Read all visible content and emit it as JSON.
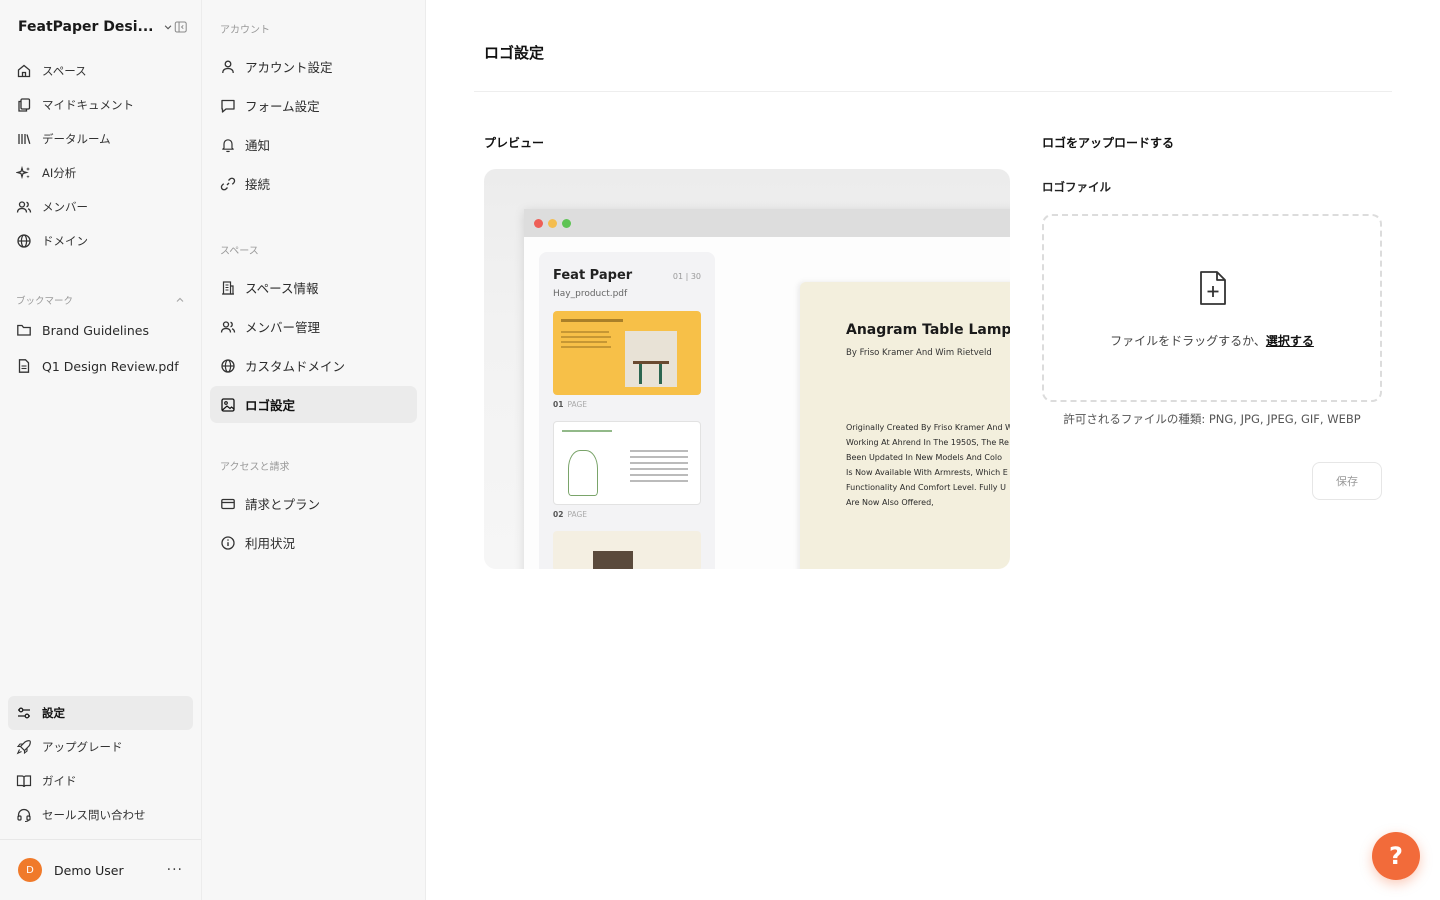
{
  "workspace": {
    "name": "FeatPaper Desi..."
  },
  "sidebar": {
    "items": [
      {
        "label": "スペース",
        "icon": "home-icon"
      },
      {
        "label": "マイドキュメント",
        "icon": "documents-icon"
      },
      {
        "label": "データルーム",
        "icon": "library-icon"
      },
      {
        "label": "AI分析",
        "icon": "sparkles-icon"
      },
      {
        "label": "メンバー",
        "icon": "users-icon"
      },
      {
        "label": "ドメイン",
        "icon": "globe-icon"
      }
    ],
    "bookmarks_title": "ブックマーク",
    "bookmarks": [
      {
        "label": "Brand Guidelines",
        "icon": "folder-icon"
      },
      {
        "label": "Q1 Design Review.pdf",
        "icon": "file-icon"
      }
    ],
    "bottom_items": [
      {
        "label": "設定",
        "icon": "sliders-icon",
        "active": true
      },
      {
        "label": "アップグレード",
        "icon": "rocket-icon"
      },
      {
        "label": "ガイド",
        "icon": "book-icon"
      },
      {
        "label": "セールス問い合わせ",
        "icon": "headset-icon"
      }
    ],
    "user": {
      "initial": "D",
      "name": "Demo User",
      "more": "···"
    }
  },
  "subnav": {
    "sections": [
      {
        "title": "アカウント",
        "items": [
          {
            "label": "アカウント設定",
            "icon": "user-icon"
          },
          {
            "label": "フォーム設定",
            "icon": "message-square-icon"
          },
          {
            "label": "通知",
            "icon": "bell-icon"
          },
          {
            "label": "接続",
            "icon": "link-icon"
          }
        ]
      },
      {
        "title": "スペース",
        "items": [
          {
            "label": "スペース情報",
            "icon": "building-icon"
          },
          {
            "label": "メンバー管理",
            "icon": "users-icon"
          },
          {
            "label": "カスタムドメイン",
            "icon": "globe-icon"
          },
          {
            "label": "ロゴ設定",
            "icon": "image-icon",
            "active": true
          }
        ]
      },
      {
        "title": "アクセスと請求",
        "items": [
          {
            "label": "請求とプラン",
            "icon": "credit-card-icon"
          },
          {
            "label": "利用状況",
            "icon": "info-icon"
          }
        ]
      }
    ]
  },
  "main": {
    "title": "ロゴ設定",
    "preview_label": "プレビュー",
    "preview": {
      "brand": "Feat Paper",
      "page_count": "01 | 30",
      "file_name": "Hay_product.pdf",
      "thumb1_label": "01",
      "thumb2_label": "02",
      "page_word": "PAGE",
      "doc_title": "Anagram Table Lamp",
      "doc_subtitle": "By Friso Kramer And Wim Rietveld",
      "doc_lines": [
        "Originally Created By Friso Kramer And W",
        "Working At Ahrend In The 1950S, The Re",
        "Been Updated In New Models And Colo",
        "Is Now Available With Armrests, Which E",
        "Functionality And Comfort Level. Fully U",
        "Are Now Also Offered,"
      ]
    },
    "upload_label": "ロゴをアップロードする",
    "file_label": "ロゴファイル",
    "dropzone_text": "ファイルをドラッグするか、",
    "dropzone_link": "選択する",
    "allowed_types": "許可されるファイルの種類: PNG, JPG, JPEG, GIF, WEBP",
    "save_label": "保存",
    "help_label": "?"
  },
  "colors": {
    "accent": "#f26b3a",
    "avatar": "#f07a2a",
    "preview_yellow": "#f7c048"
  }
}
